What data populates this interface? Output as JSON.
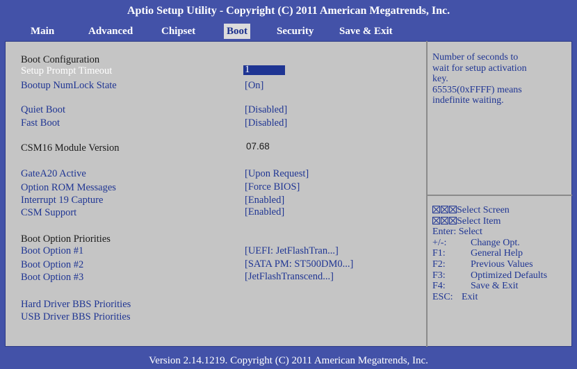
{
  "title": "Aptio Setup Utility - Copyright (C) 2011 American Megatrends, Inc.",
  "tabs": [
    "Main",
    "Advanced",
    "Chipset",
    "Boot",
    "Security",
    "Save & Exit"
  ],
  "active_tab": "Boot",
  "settings": {
    "section_boot_config": "Boot Configuration",
    "setup_prompt_timeout": {
      "label": "Setup Prompt Timeout",
      "value": "1"
    },
    "bootup_numlock": {
      "label": "Bootup NumLock State",
      "value": "[On]"
    },
    "quiet_boot": {
      "label": "Quiet Boot",
      "value": "[Disabled]"
    },
    "fast_boot": {
      "label": "Fast Boot",
      "value": "[Disabled]"
    },
    "csm16": {
      "label": "CSM16 Module Version",
      "value": "07.68"
    },
    "gatea20": {
      "label": "GateA20 Active",
      "value": "[Upon Request]"
    },
    "option_rom": {
      "label": "Option ROM Messages",
      "value": "[Force BIOS]"
    },
    "int19": {
      "label": "Interrupt 19 Capture",
      "value": "[Enabled]"
    },
    "csm_support": {
      "label": "CSM Support",
      "value": "[Enabled]"
    },
    "section_boot_priorities": "Boot Option Priorities",
    "boot_option_1": {
      "label": "Boot Option #1",
      "value": "[UEFI: JetFlashTran...]"
    },
    "boot_option_2": {
      "label": "Boot Option #2",
      "value": "[SATA PM: ST500DM0...]"
    },
    "boot_option_3": {
      "label": "Boot Option #3",
      "value": "[JetFlashTranscend...]"
    },
    "hdd_bbs": "Hard Driver BBS Priorities",
    "usb_bbs": "USB Driver BBS Priorities"
  },
  "help": {
    "line1": "Number of seconds to",
    "line2": "wait for setup activation",
    "line3": "key.",
    "line4": "65535(0xFFFF) means",
    "line5": "indefinite waiting."
  },
  "keys": {
    "select_screen": "Select Screen",
    "select_item": "Select Item",
    "enter": "Enter: Select",
    "change_key": "+/-:",
    "change_desc": "Change Opt.",
    "f1_key": "F1:",
    "f1_desc": "General Help",
    "f2_key": "F2:",
    "f2_desc": "Previous Values",
    "f3_key": "F3:",
    "f3_desc": "Optimized Defaults",
    "f4_key": "F4:",
    "f4_desc": "Save & Exit",
    "esc_key": "ESC:",
    "esc_desc": "Exit"
  },
  "footer": "Version 2.14.1219. Copyright (C) 2011 American Megatrends, Inc."
}
